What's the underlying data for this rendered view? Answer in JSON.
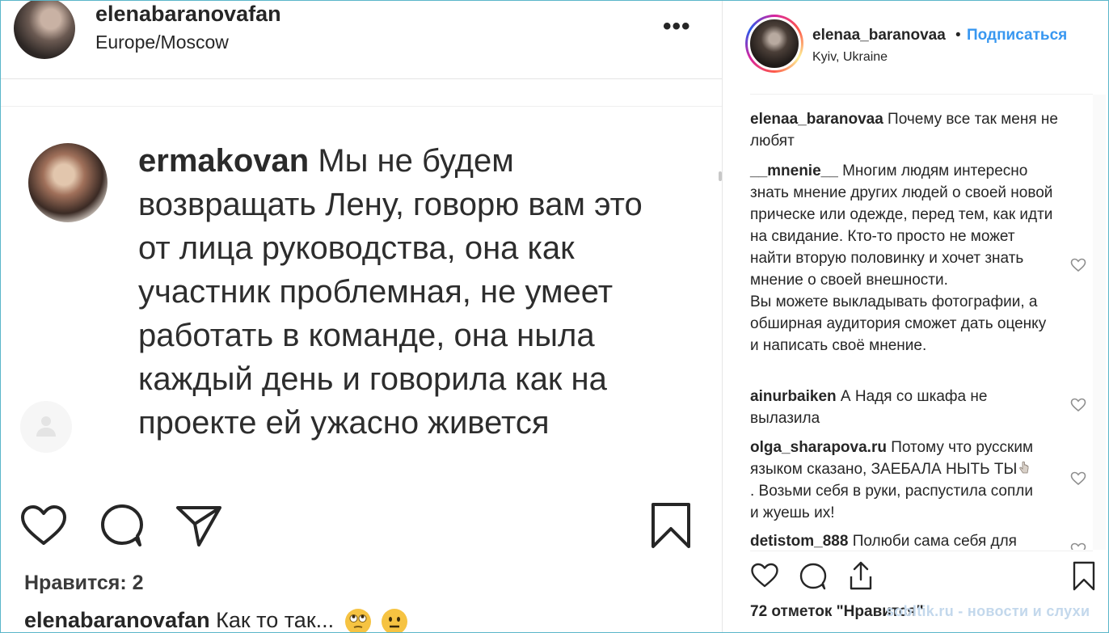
{
  "left_post": {
    "username": "elenabaranovafan",
    "location": "Europe/Moscow",
    "more": "•••",
    "quote": {
      "username": "ermakovan",
      "text": " Мы не будем возвращать Лену, говорю вам это от лица руководства, она как участник проблемная, не умеет работать в команде, она ныла каждый день и говорила как на проекте ей ужасно живется"
    },
    "likes": "Нравится: 2",
    "caption": {
      "username": "elenabaranovafan",
      "text": " Как то так..."
    },
    "icons": [
      "heart-icon",
      "comment-icon",
      "share-icon",
      "bookmark-icon"
    ]
  },
  "right_panel": {
    "username": "elenaa_baranovaa",
    "bullet": "•",
    "follow_label": "Подписаться",
    "location": "Kyiv, Ukraine",
    "comments": [
      {
        "user": "elenaa_baranovaa",
        "text": " Почему все так меня не любят"
      },
      {
        "user": "__mnenie__",
        "text": " Многим людям интересно знать мнение других людей о своей новой прическе или одежде, перед тем, как идти на свидание. Кто-то просто не может найти вторую половинку и хочет знать мнение о своей внешности.",
        "text2": "Вы можете выкладывать фотографии, а обширная аудитория сможет дать оценку и написать своё мнение."
      },
      {
        "user": "ainurbaiken",
        "text": " А Надя со шкафа не вылазила"
      },
      {
        "user": "olga_sharapova.ru",
        "text_a": " Потому что русским языком сказано, ЗАЕБАЛА НЫТЬ ТЫ",
        "text_b": ". Возьми себя в руки, распустила сопли и жуешь их!"
      },
      {
        "user": "detistom_888",
        "text": " Полюби сама себя для"
      }
    ],
    "likes": "72 отметок \"Нравится\"",
    "icons": [
      "heart-icon",
      "comment-icon",
      "share-icon",
      "bookmark-icon"
    ]
  },
  "watermark": "sobltik.ru - новости и слухи",
  "colors": {
    "link": "#3897f0",
    "text": "#262626",
    "divider": "#efefef"
  }
}
